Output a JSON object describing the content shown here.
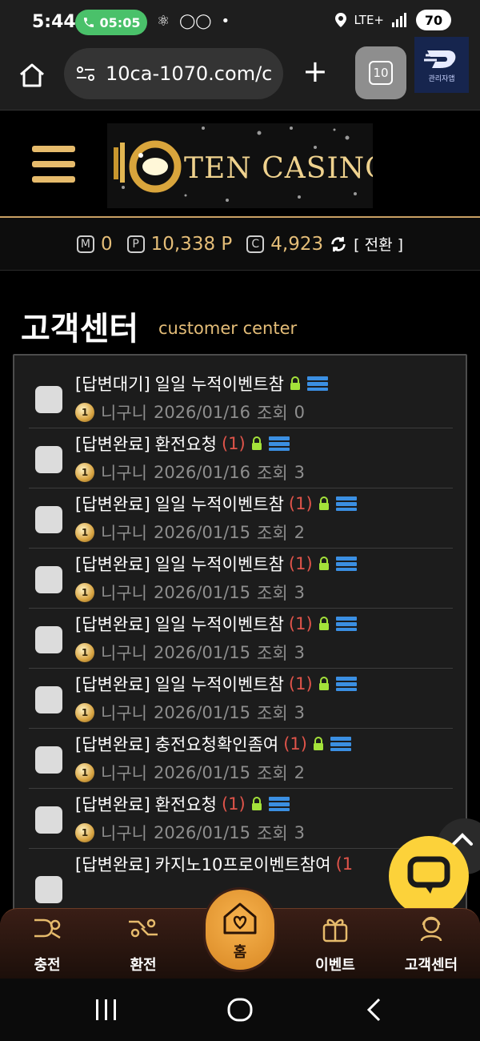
{
  "status_bar": {
    "time": "5:44",
    "call_time": "05:05",
    "network": "LTE+",
    "battery": "70"
  },
  "browser": {
    "url": "10ca-1070.com/c",
    "tab_count": "10",
    "admin_label": "관리자앱"
  },
  "header": {
    "logo_text": "TEN CASINO"
  },
  "points": {
    "m_badge": "M",
    "m_value": "0",
    "p_badge": "P",
    "p_value": "10,338 P",
    "c_badge": "C",
    "c_value": "4,923",
    "switch_label": "[ 전환 ]"
  },
  "page": {
    "title": "고객센터",
    "subtitle": "customer center"
  },
  "rows": [
    {
      "status": "[답변대기]",
      "title": "일일 누적이벤트참",
      "replies": "",
      "author": "니구니",
      "date": "2026/01/16",
      "views_label": "조회",
      "views": "0"
    },
    {
      "status": "[답변완료]",
      "title": "환전요청",
      "replies": "(1)",
      "author": "니구니",
      "date": "2026/01/16",
      "views_label": "조회",
      "views": "3"
    },
    {
      "status": "[답변완료]",
      "title": "일일 누적이벤트참",
      "replies": "(1)",
      "author": "니구니",
      "date": "2026/01/15",
      "views_label": "조회",
      "views": "2"
    },
    {
      "status": "[답변완료]",
      "title": "일일 누적이벤트참",
      "replies": "(1)",
      "author": "니구니",
      "date": "2026/01/15",
      "views_label": "조회",
      "views": "3"
    },
    {
      "status": "[답변완료]",
      "title": "일일 누적이벤트참",
      "replies": "(1)",
      "author": "니구니",
      "date": "2026/01/15",
      "views_label": "조회",
      "views": "3"
    },
    {
      "status": "[답변완료]",
      "title": "일일 누적이벤트참",
      "replies": "(1)",
      "author": "니구니",
      "date": "2026/01/15",
      "views_label": "조회",
      "views": "3"
    },
    {
      "status": "[답변완료]",
      "title": "충전요청확인좀여",
      "replies": "(1)",
      "author": "니구니",
      "date": "2026/01/15",
      "views_label": "조회",
      "views": "2"
    },
    {
      "status": "[답변완료]",
      "title": "환전요청",
      "replies": "(1)",
      "author": "니구니",
      "date": "2026/01/15",
      "views_label": "조회",
      "views": "3"
    },
    {
      "status": "[답변완료]",
      "title": "카지노10프로이벤트참여",
      "replies": "(1",
      "author": "",
      "date": "",
      "views_label": "",
      "views": ""
    }
  ],
  "bottom_nav": {
    "charge": "충전",
    "exchange": "환전",
    "home": "홈",
    "event": "이벤트",
    "support": "고객센터"
  },
  "colors": {
    "gold": "#e4bd78",
    "accent_orange": "#d98824",
    "chat_yellow": "#fcd23a",
    "reply_red": "#e0544a"
  }
}
